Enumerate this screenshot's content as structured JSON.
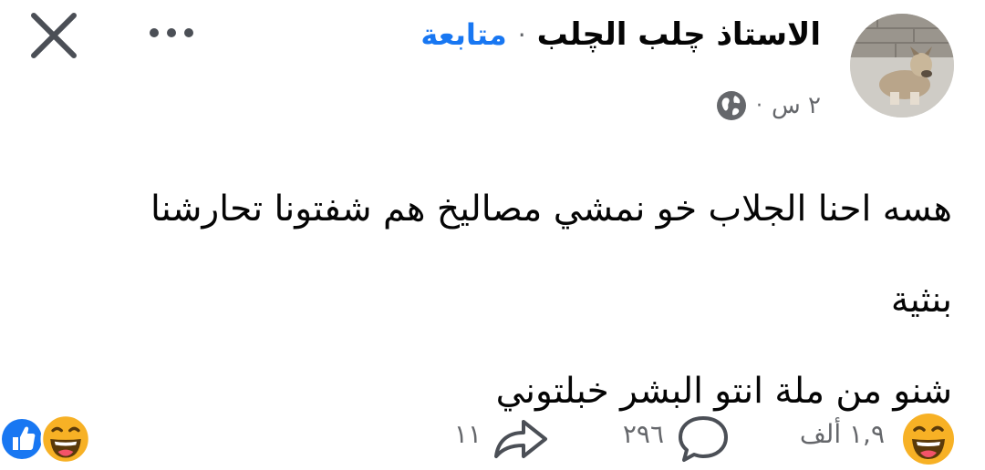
{
  "header": {
    "author_name": "الاستاذ چلب الچلب",
    "separator": "·",
    "follow_label": "متابعة",
    "time": "٢ س",
    "meta_separator": "·"
  },
  "post": {
    "lines": [
      "هسه احنا الجلاب خو نمشي مصاليخ هم شفتونا تحارشنا",
      "بنثية",
      "شنو من ملة انتو البشر خبلتوني"
    ]
  },
  "footer": {
    "reactions_count": "١,٩ ألف",
    "comments_count": "٢٩٦",
    "shares_count": "١١"
  },
  "icons": {
    "close": "close-icon",
    "more": "more-icon",
    "globe": "globe-icon",
    "haha": "haha-reaction-icon",
    "comment": "comment-icon",
    "share": "share-icon",
    "like": "like-reaction-icon"
  },
  "colors": {
    "follow": "#1877f2",
    "meta_text": "#65676b",
    "haha_face": "#f7b125",
    "like_blue": "#1877f2"
  }
}
